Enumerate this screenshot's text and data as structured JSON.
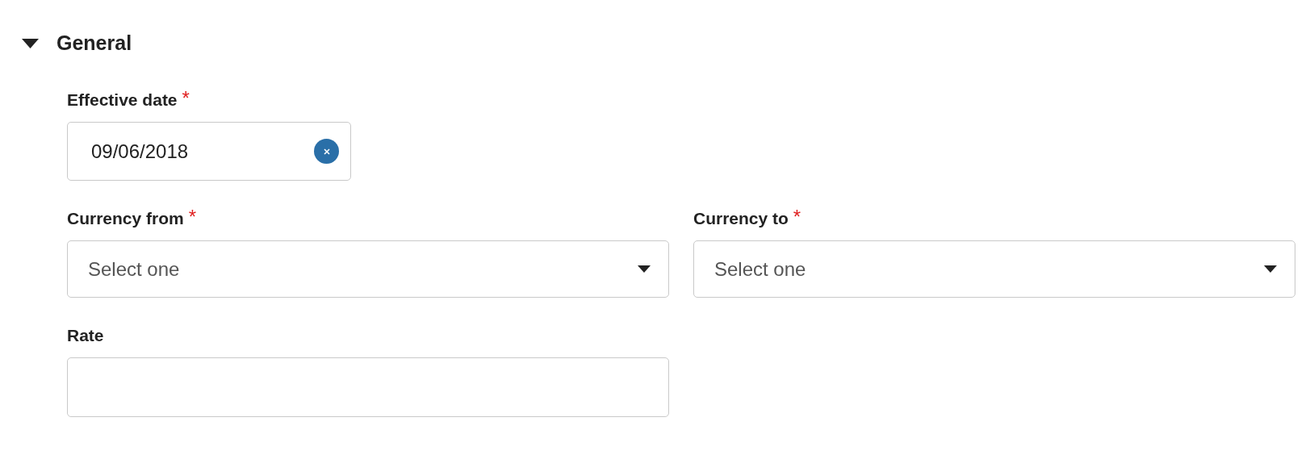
{
  "section": {
    "title": "General",
    "expanded": true
  },
  "rows": [
    [
      {
        "kind": "date",
        "label": "Effective date",
        "required_mark": "*",
        "value": "09/06/2018"
      }
    ],
    [
      {
        "kind": "select",
        "label": "Currency from",
        "required_mark": "*",
        "placeholder": "Select one"
      },
      {
        "kind": "select",
        "label": "Currency to",
        "required_mark": "*",
        "placeholder": "Select one"
      }
    ],
    [
      {
        "kind": "text",
        "label": "Rate"
      }
    ]
  ]
}
